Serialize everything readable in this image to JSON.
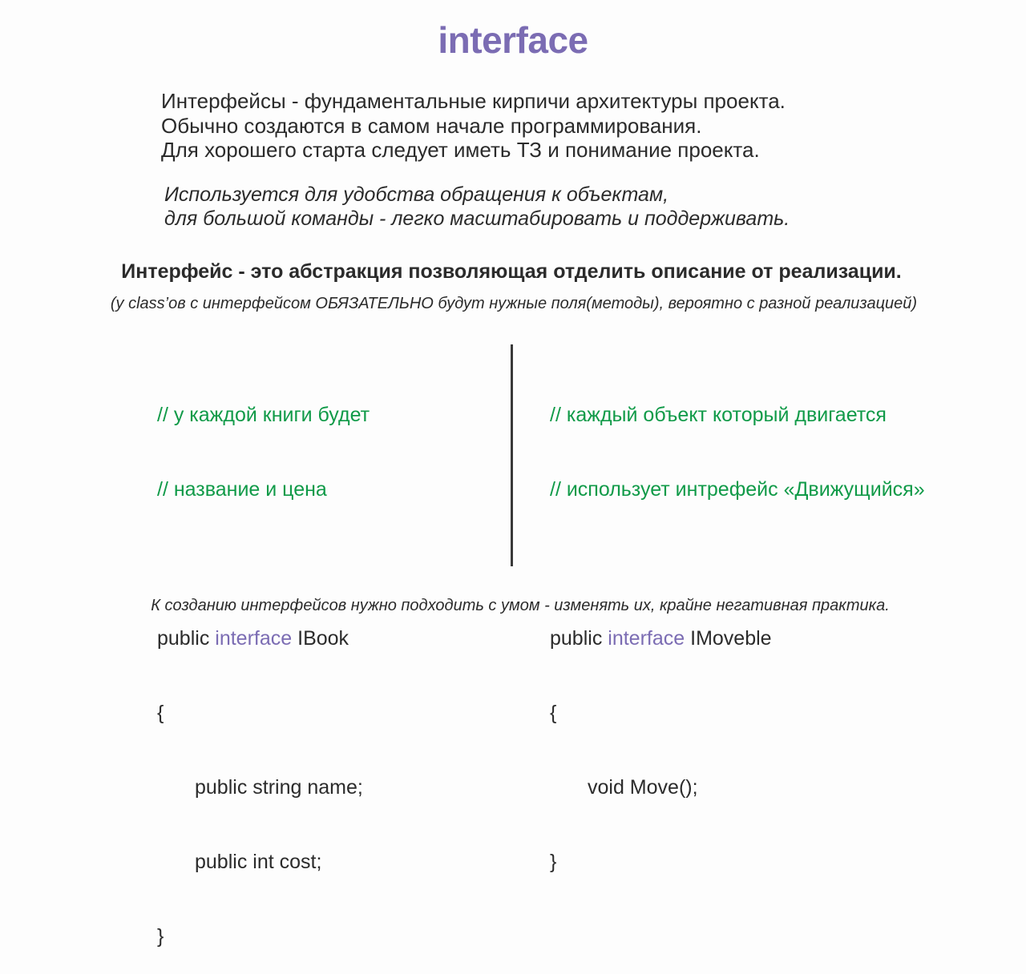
{
  "title": "interface",
  "intro": {
    "lines": [
      "Интерфейсы - фундаментальные кирпичи архитектуры проекта.",
      "Обычно создаются в самом начале программирования.",
      "Для хорошего старта следует иметь ТЗ и понимание проекта."
    ]
  },
  "usage": {
    "lines": [
      "Используется для удобства обращения к объектам,",
      "для большой команды - легко масштабировать и поддерживать."
    ]
  },
  "definition": "Интерфейс - это абстракция позволяющая отделить описание от реализации.",
  "note": "(у class’ов с интерфейсом ОБЯЗАТЕЛЬНО будут нужные поля(методы), вероятно с разной реализацией)",
  "colors": {
    "accent": "#7b6cb3",
    "comment": "#109a48",
    "text": "#2b2b2b"
  },
  "examples": {
    "left": {
      "comments": [
        "// у каждой книги будет",
        "// название и цена"
      ],
      "declaration": {
        "modifier": "public",
        "keyword": "interface",
        "name": "IBook"
      },
      "open_brace": "{",
      "members": [
        "public string name;",
        "public int cost;"
      ],
      "close_brace": "}"
    },
    "right": {
      "comments": [
        "// каждый объект который двигается",
        "// использует интрефейс «Движущийся»"
      ],
      "declaration": {
        "modifier": "public",
        "keyword": "interface",
        "name": "IMoveble"
      },
      "open_brace": "{",
      "members": [
        "void Move();"
      ],
      "close_brace": "}"
    }
  },
  "footer": "К созданию интерфейсов нужно подходить с умом - изменять их, крайне негативная практика."
}
